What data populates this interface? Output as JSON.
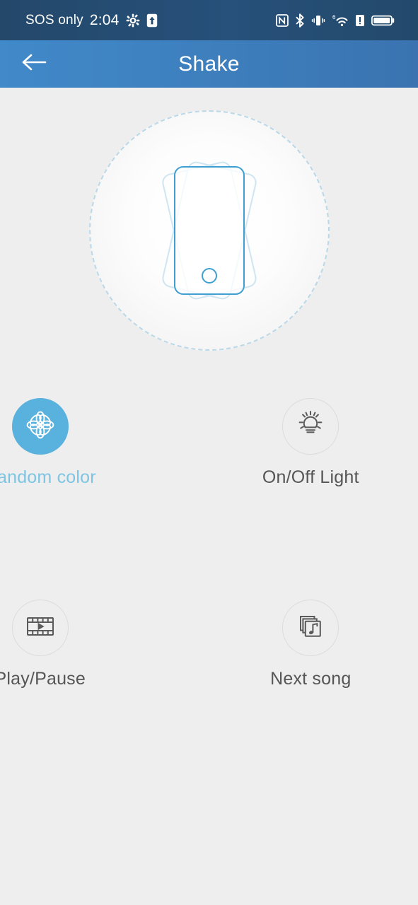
{
  "statusbar": {
    "carrier": "SOS only",
    "time": "2:04",
    "left_icons": [
      {
        "name": "gear-icon",
        "glyph": "✿"
      },
      {
        "name": "upload-arrow-icon",
        "glyph": "↑"
      }
    ],
    "right_icons": [
      {
        "name": "nfc-icon",
        "label": "N"
      },
      {
        "name": "bluetooth-icon",
        "label": "B"
      },
      {
        "name": "vibrate-icon",
        "label": "vib"
      },
      {
        "name": "wifi-icon",
        "label": "6"
      },
      {
        "name": "alert-icon",
        "label": "!"
      },
      {
        "name": "battery-icon",
        "label": "batt"
      }
    ],
    "background_color": "#234a6b",
    "text_color": "#ffffff"
  },
  "header": {
    "title": "Shake",
    "back_icon": "arrow-left-icon",
    "background_color": "#3e80bf",
    "text_color": "#ffffff"
  },
  "hero": {
    "icon": "shaking-phone-icon",
    "outline_color": "#3e9fd0",
    "ghost_color": "#cfe6f2",
    "dashed_circle_color": "#b9d8e8"
  },
  "actions": [
    {
      "id": "random-color",
      "label": "Random color",
      "icon": "flower-icon",
      "active": true,
      "active_color": "#59b1dd",
      "label_color": "#7ec5e4"
    },
    {
      "id": "on-off-light",
      "label": "On/Off Light",
      "icon": "lightbulb-icon",
      "active": false,
      "label_color": "#555555"
    },
    {
      "id": "play-pause",
      "label": "Play/Pause",
      "icon": "film-play-icon",
      "active": false,
      "label_color": "#555555"
    },
    {
      "id": "next-song",
      "label": "Next song",
      "icon": "music-note-stack-icon",
      "active": false,
      "label_color": "#555555"
    }
  ],
  "page": {
    "background_color": "#eeeeee"
  }
}
